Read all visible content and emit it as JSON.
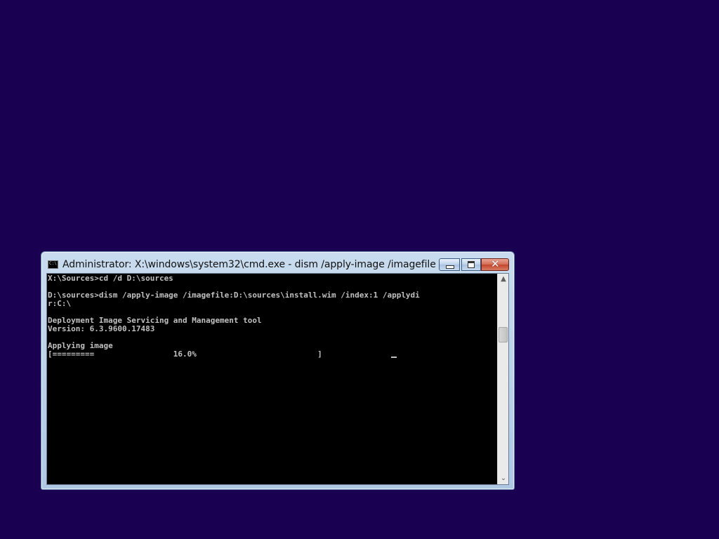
{
  "window": {
    "title": "Administrator: X:\\windows\\system32\\cmd.exe - dism  /apply-image /imagefile:...",
    "icon": "cmd-console-icon",
    "icon_label": "C:\\"
  },
  "caption_buttons": {
    "minimize": "minimize-icon",
    "maximize": "maximize-icon",
    "close": "close-icon"
  },
  "console": {
    "lines": [
      "X:\\Sources>cd /d D:\\sources",
      "",
      "D:\\sources>dism /apply-image /imagefile:D:\\sources\\install.wim /index:1 /applydi",
      "r:C:\\",
      "",
      "Deployment Image Servicing and Management tool",
      "Version: 6.3.9600.17483",
      "",
      "Applying image",
      "[=========                 16.0%                          ] "
    ],
    "progress_percent": 16.0
  },
  "scrollbar": {
    "up_arrow": "chevron-up-icon",
    "down_arrow": "chevron-down-icon"
  },
  "colors": {
    "desktop_background": "#1a0050",
    "console_background": "#000000",
    "console_text": "#c0c0c0",
    "window_frame": "#c9dcef",
    "close_button": "#c2452c"
  }
}
